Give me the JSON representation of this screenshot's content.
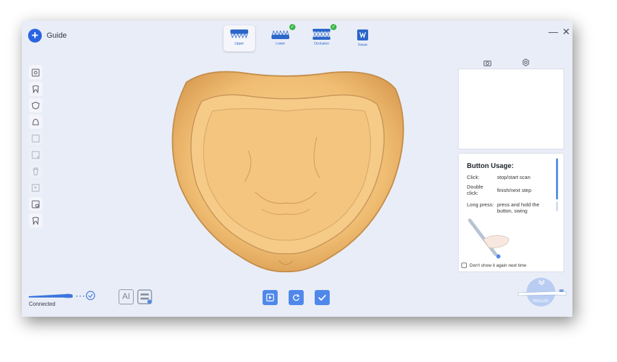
{
  "header": {
    "guide_label": "Guide",
    "minimize": "—",
    "close": "✕"
  },
  "steps": [
    {
      "label": "Upper",
      "completed": false,
      "active": true
    },
    {
      "label": "Lower",
      "completed": true,
      "active": false
    },
    {
      "label": "Occlusion",
      "completed": true,
      "active": false
    },
    {
      "label": "Finish",
      "completed": false,
      "active": false
    }
  ],
  "toolbar": {
    "items": [
      {
        "icon": "view-icon",
        "enabled": true
      },
      {
        "icon": "tooth-icon",
        "enabled": true
      },
      {
        "icon": "shield-tooth-icon",
        "enabled": true
      },
      {
        "icon": "bell-shape-icon",
        "enabled": true
      },
      {
        "icon": "select-region-icon",
        "enabled": false
      },
      {
        "icon": "trim-icon",
        "enabled": false
      },
      {
        "icon": "trash-icon",
        "enabled": false
      },
      {
        "icon": "undo-icon",
        "enabled": false
      },
      {
        "icon": "image-settings-icon",
        "enabled": true
      },
      {
        "icon": "tooth-alt-icon",
        "enabled": true
      }
    ]
  },
  "preview": {
    "camera_icon": "camera-icon",
    "settings_icon": "settings-icon"
  },
  "usage": {
    "title": "Button Usage:",
    "rows": [
      {
        "key": "Click:",
        "value": "stop/start scan"
      },
      {
        "key": "Double click:",
        "value": "finish/next step"
      },
      {
        "key": "Long press:",
        "value": "press and hold the button, swing"
      }
    ],
    "dont_show": "Don't show it again next time"
  },
  "status": {
    "connection": "Connected"
  },
  "bottom": {
    "ai_label": "AI"
  },
  "device": {
    "name": "PRO100"
  },
  "colors": {
    "accent": "#2b63e3",
    "button": "#4f88ea",
    "model_fill": "#f2c27c",
    "model_edge": "#c58f4d"
  }
}
